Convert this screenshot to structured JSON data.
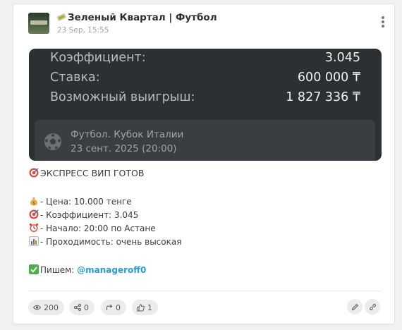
{
  "post": {
    "channel_title": "Зеленый Квартал | Футбол",
    "date": "23 Sep, 15:55"
  },
  "ticket": {
    "rows": [
      {
        "label": "Коэффициент:",
        "value": "3.045"
      },
      {
        "label": "Ставка:",
        "value": "600 000 ₸"
      },
      {
        "label": "Возможный выигрыш:",
        "value": "1 827 336 ₸"
      }
    ],
    "match": {
      "league": "Футбол. Кубок Италии",
      "datetime": "23 сент. 2025 (20:00)"
    }
  },
  "message": {
    "headline": "ЭКСПРЕСС ВИП ГОТОВ",
    "price": "- Цена: 10.000 тенге",
    "coef": "- Коэффициент: 3.045",
    "start": "- Начало: 20:00 по Астане",
    "pass": "- Проходимость: очень высокая",
    "write_label": "Пишем: ",
    "mention": "@manageroff0"
  },
  "stats": {
    "views": "200",
    "shares": "0",
    "forwards": "0",
    "likes": "1"
  },
  "icons": {
    "headline": "target-emoji",
    "price": "money-bag-emoji",
    "coef": "target-emoji",
    "start": "alarm-clock-emoji",
    "pass": "bar-chart-emoji",
    "write": "check-mark-emoji"
  },
  "colors": {
    "ticket_bg": "#2c3033",
    "ticket_inner": "#3a3e42",
    "mention": "#2a9bd6"
  }
}
